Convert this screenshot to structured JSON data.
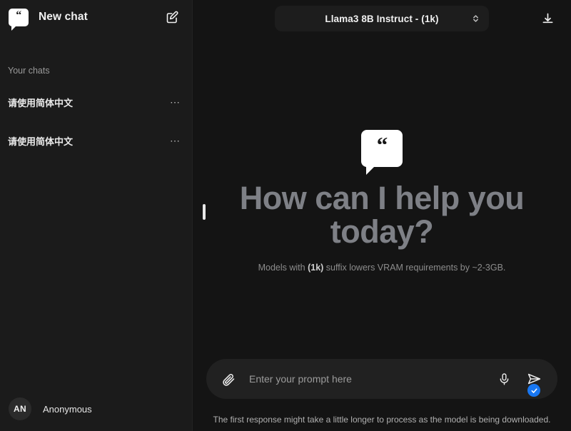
{
  "sidebar": {
    "brand": "New chat",
    "logo_icon": "chat-bubble-quote-icon",
    "compose_icon": "compose-pencil-square-icon",
    "section_label": "Your chats",
    "chats": [
      {
        "title": "请使用简体中文",
        "menu_icon": "ellipsis-horizontal-icon"
      },
      {
        "title": "请使用简体中文",
        "menu_icon": "ellipsis-horizontal-icon"
      }
    ],
    "user": {
      "initials": "AN",
      "name": "Anonymous"
    },
    "collapse_handle": "sidebar-collapse-handle"
  },
  "topbar": {
    "model": "Llama3 8B Instruct - (1k)",
    "chevron_icon": "chevron-up-down-icon",
    "download_icon": "download-tray-icon"
  },
  "hero": {
    "bubble_icon": "chat-bubble-quote-icon",
    "title": "How can I help you today?",
    "subtitle_before": "Models with ",
    "subtitle_strong": "(1k)",
    "subtitle_after": " suffix lowers VRAM requirements by ~2-3GB."
  },
  "composer": {
    "attach_icon": "paperclip-icon",
    "placeholder": "Enter your prompt here",
    "value": "",
    "mic_icon": "microphone-icon",
    "send_icon": "send-paper-plane-icon",
    "badge_icon": "check-circle-icon",
    "disclaimer": "The first response might take a little longer to process as the model is being downloaded."
  },
  "colors": {
    "app_bg": "#141414",
    "sidebar_bg": "#1b1b1b",
    "composer_bg": "#212121",
    "accent_blue": "#1877f2",
    "hero_text": "#7e8086"
  }
}
